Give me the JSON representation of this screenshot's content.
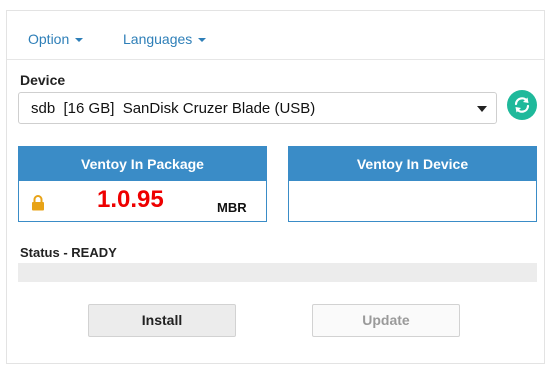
{
  "menu": {
    "option_label": "Option",
    "languages_label": "Languages"
  },
  "device": {
    "label": "Device",
    "selected": "sdb  [16 GB]  SanDisk Cruzer Blade (USB)"
  },
  "package_panel": {
    "title": "Ventoy In Package",
    "version": "1.0.95",
    "partition_style": "MBR"
  },
  "device_panel": {
    "title": "Ventoy In Device"
  },
  "status": {
    "text": "Status - READY",
    "progress_fraction": 0
  },
  "buttons": {
    "install_label": "Install",
    "update_label": "Update"
  },
  "colors": {
    "accent": "#3a8cc7",
    "refresh": "#1fb99b",
    "version": "#ee0000",
    "lock": "#e8a317"
  }
}
